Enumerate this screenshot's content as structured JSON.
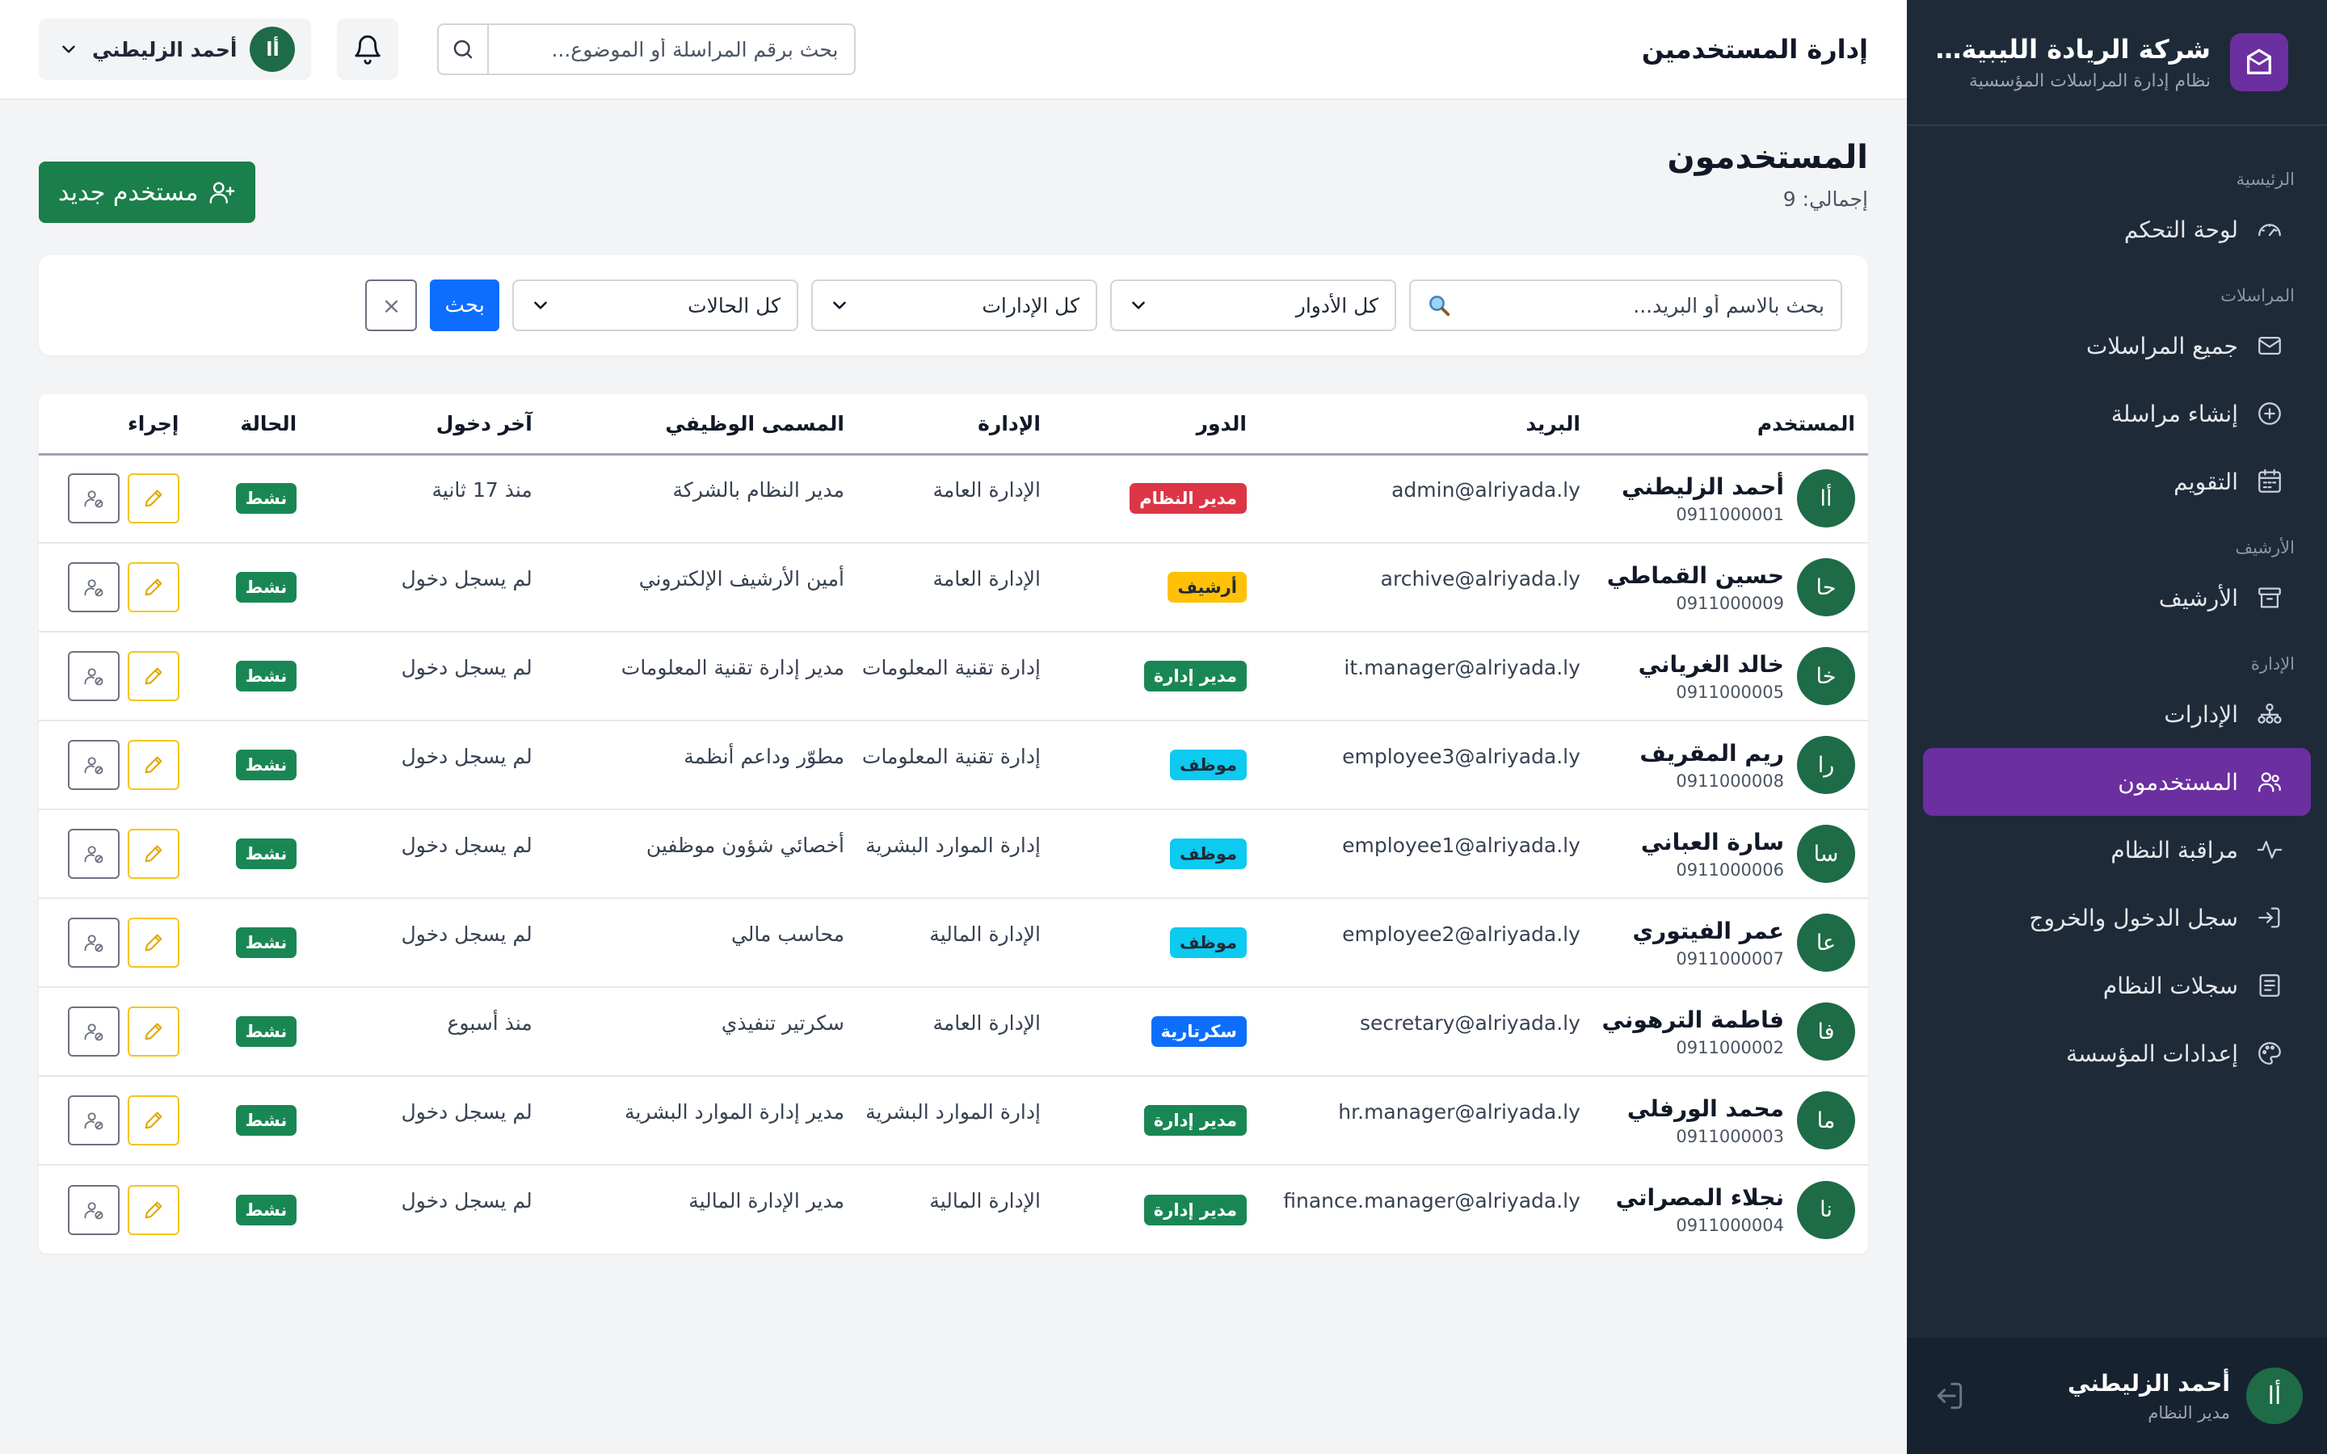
{
  "brand": {
    "title": "شركة الريادة الليبية للحـ...",
    "subtitle": "نظام إدارة المراسلات المؤسسية"
  },
  "sidebar": {
    "sections": [
      {
        "title": "الرئيسية",
        "items": [
          {
            "label": "لوحة التحكم",
            "icon": "dashboard-gauge-icon",
            "active": false
          }
        ]
      },
      {
        "title": "المراسلات",
        "items": [
          {
            "label": "جميع المراسلات",
            "icon": "envelope-icon",
            "active": false
          },
          {
            "label": "إنشاء مراسلة",
            "icon": "plus-circle-icon",
            "active": false
          },
          {
            "label": "التقويم",
            "icon": "calendar-icon",
            "active": false
          }
        ]
      },
      {
        "title": "الأرشيف",
        "items": [
          {
            "label": "الأرشيف",
            "icon": "archive-box-icon",
            "active": false
          }
        ]
      },
      {
        "title": "الإدارة",
        "items": [
          {
            "label": "الإدارات",
            "icon": "org-chart-icon",
            "active": false
          },
          {
            "label": "المستخدمون",
            "icon": "users-icon",
            "active": true
          },
          {
            "label": "مراقبة النظام",
            "icon": "activity-pulse-icon",
            "active": false
          },
          {
            "label": "سجل الدخول والخروج",
            "icon": "login-arrow-icon",
            "active": false
          },
          {
            "label": "سجلات النظام",
            "icon": "log-list-icon",
            "active": false
          },
          {
            "label": "إعدادات المؤسسة",
            "icon": "palette-icon",
            "active": false
          }
        ]
      }
    ],
    "user": {
      "initial": "أا",
      "name": "أحمد الزليطني",
      "role": "مدير النظام"
    }
  },
  "topbar": {
    "title": "إدارة المستخدمين",
    "search_placeholder": "بحث برقم المراسلة أو الموضوع...",
    "user_initial": "أا",
    "user_name": "أحمد الزليطني"
  },
  "page": {
    "title": "المستخدمون",
    "count_text": "إجمالي: 9",
    "new_user_label": "مستخدم جديد"
  },
  "filters": {
    "search_placeholder": "بحث بالاسم أو البريد...",
    "role": "كل الأدوار",
    "department": "كل الإدارات",
    "status": "كل الحالات",
    "search_button": "بحث",
    "clear_button": "×"
  },
  "table": {
    "headers": [
      "المستخدم",
      "البريد",
      "الدور",
      "الإدارة",
      "المسمى الوظيفي",
      "آخر دخول",
      "الحالة",
      "إجراء"
    ],
    "rows": [
      {
        "initial": "أا",
        "name": "أحمد الزليطني",
        "phone": "0911000001",
        "email": "admin@alriyada.ly",
        "role": "مدير النظام",
        "role_color": "#dc3545",
        "role_text_color": "#ffffff",
        "department": "الإدارة العامة",
        "job_title": "مدير النظام بالشركة",
        "last_login": "منذ 17 ثانية",
        "status": "نشط"
      },
      {
        "initial": "حا",
        "name": "حسين القماطي",
        "phone": "0911000009",
        "email": "archive@alriyada.ly",
        "role": "أرشيف",
        "role_color": "#ffc107",
        "role_text_color": "#1f2937",
        "department": "الإدارة العامة",
        "job_title": "أمين الأرشيف الإلكتروني",
        "last_login": "لم يسجل دخول",
        "status": "نشط"
      },
      {
        "initial": "خا",
        "name": "خالد الغرياني",
        "phone": "0911000005",
        "email": "it.manager@alriyada.ly",
        "role": "مدير إدارة",
        "role_color": "#198754",
        "role_text_color": "#ffffff",
        "department": "إدارة تقنية المعلومات",
        "job_title": "مدير إدارة تقنية المعلومات",
        "last_login": "لم يسجل دخول",
        "status": "نشط"
      },
      {
        "initial": "را",
        "name": "ريم المقريف",
        "phone": "0911000008",
        "email": "employee3@alriyada.ly",
        "role": "موظف",
        "role_color": "#0dcaf0",
        "role_text_color": "#1f2937",
        "department": "إدارة تقنية المعلومات",
        "job_title": "مطوّر وداعم أنظمة",
        "last_login": "لم يسجل دخول",
        "status": "نشط"
      },
      {
        "initial": "سا",
        "name": "سارة العباني",
        "phone": "0911000006",
        "email": "employee1@alriyada.ly",
        "role": "موظف",
        "role_color": "#0dcaf0",
        "role_text_color": "#1f2937",
        "department": "إدارة الموارد البشرية",
        "job_title": "أخصائي شؤون موظفين",
        "last_login": "لم يسجل دخول",
        "status": "نشط"
      },
      {
        "initial": "عا",
        "name": "عمر الفيتوري",
        "phone": "0911000007",
        "email": "employee2@alriyada.ly",
        "role": "موظف",
        "role_color": "#0dcaf0",
        "role_text_color": "#1f2937",
        "department": "الإدارة المالية",
        "job_title": "محاسب مالي",
        "last_login": "لم يسجل دخول",
        "status": "نشط"
      },
      {
        "initial": "فا",
        "name": "فاطمة الترهوني",
        "phone": "0911000002",
        "email": "secretary@alriyada.ly",
        "role": "سكرتارية",
        "role_color": "#0d6efd",
        "role_text_color": "#ffffff",
        "department": "الإدارة العامة",
        "job_title": "سكرتير تنفيذي",
        "last_login": "منذ أسبوع",
        "status": "نشط"
      },
      {
        "initial": "ما",
        "name": "محمد الورفلي",
        "phone": "0911000003",
        "email": "hr.manager@alriyada.ly",
        "role": "مدير إدارة",
        "role_color": "#198754",
        "role_text_color": "#ffffff",
        "department": "إدارة الموارد البشرية",
        "job_title": "مدير إدارة الموارد البشرية",
        "last_login": "لم يسجل دخول",
        "status": "نشط"
      },
      {
        "initial": "نا",
        "name": "نجلاء المصراتي",
        "phone": "0911000004",
        "email": "finance.manager@alriyada.ly",
        "role": "مدير إدارة",
        "role_color": "#198754",
        "role_text_color": "#ffffff",
        "department": "الإدارة المالية",
        "job_title": "مدير الإدارة المالية",
        "last_login": "لم يسجل دخول",
        "status": "نشط"
      }
    ]
  },
  "colors": {
    "sidebar_bg": "#1e2a38",
    "accent_purple": "#6b2fa0",
    "primary_green": "#1a7f4b",
    "avatar_green": "#1e6b47",
    "status_green": "#198754",
    "primary_blue": "#0d6efd"
  }
}
